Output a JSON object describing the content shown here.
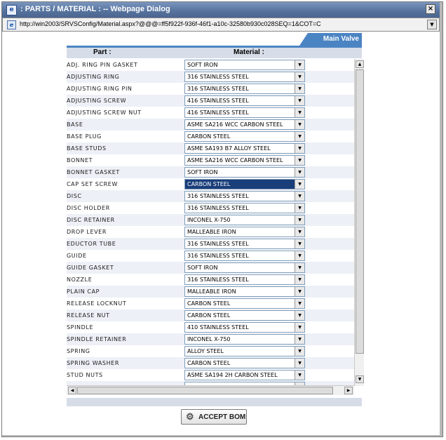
{
  "window": {
    "title": ": PARTS / MATERIAL : -- Webpage Dialog",
    "close_glyph": "×",
    "url": "http://win2003/SRVSConfig/Material.aspx?@@@=ff5f922f-936f-46f1-a10c-32580b930c028SEQ=1&COT=C"
  },
  "tab": {
    "label": "Main Valve"
  },
  "table": {
    "headers": {
      "part": "Part :",
      "material": "Material :"
    },
    "rows": [
      {
        "part": "ADJ. RING PIN GASKET",
        "material": "SOFT IRON"
      },
      {
        "part": "ADJUSTING RING",
        "material": "316 STAINLESS STEEL"
      },
      {
        "part": "ADJUSTING RING PIN",
        "material": "316 STAINLESS STEEL"
      },
      {
        "part": "ADJUSTING SCREW",
        "material": "416 STAINLESS STEEL"
      },
      {
        "part": "ADJUSTING SCREW NUT",
        "material": "416 STAINLESS STEEL"
      },
      {
        "part": "BASE",
        "material": "ASME SA216 WCC CARBON STEEL"
      },
      {
        "part": "BASE PLUG",
        "material": "CARBON STEEL"
      },
      {
        "part": "BASE STUDS",
        "material": "ASME SA193 B7 ALLOY STEEL"
      },
      {
        "part": "BONNET",
        "material": "ASME SA216 WCC CARBON STEEL"
      },
      {
        "part": "BONNET GASKET",
        "material": "SOFT IRON"
      },
      {
        "part": "CAP SET SCREW",
        "material": "CARBON STEEL",
        "selected": true
      },
      {
        "part": "DISC",
        "material": "316 STAINLESS STEEL"
      },
      {
        "part": "DISC HOLDER",
        "material": "316 STAINLESS STEEL"
      },
      {
        "part": "DISC RETAINER",
        "material": "INCONEL X-750"
      },
      {
        "part": "DROP LEVER",
        "material": "MALLEABLE IRON"
      },
      {
        "part": "EDUCTOR TUBE",
        "material": "316 STAINLESS STEEL"
      },
      {
        "part": "GUIDE",
        "material": "316 STAINLESS STEEL"
      },
      {
        "part": "GUIDE GASKET",
        "material": "SOFT IRON"
      },
      {
        "part": "NOZZLE",
        "material": "316 STAINLESS STEEL"
      },
      {
        "part": "PLAIN CAP",
        "material": "MALLEABLE IRON"
      },
      {
        "part": "RELEASE LOCKNUT",
        "material": "CARBON STEEL"
      },
      {
        "part": "RELEASE NUT",
        "material": "CARBON STEEL"
      },
      {
        "part": "SPINDLE",
        "material": "410 STAINLESS STEEL"
      },
      {
        "part": "SPINDLE RETAINER",
        "material": "INCONEL X-750"
      },
      {
        "part": "SPRING",
        "material": "ALLOY STEEL"
      },
      {
        "part": "SPRING WASHER",
        "material": "CARBON STEEL"
      },
      {
        "part": "STUD NUTS",
        "material": "ASME SA194 2H CARBON STEEL"
      },
      {
        "part": "",
        "material": ""
      }
    ]
  },
  "footer": {
    "accept_label": "ACCEPT BOM"
  },
  "colors": {
    "tab": "#4b84c3",
    "selected_row": "#1a3e7a",
    "header_band": "#d7dde8"
  },
  "icons": {
    "title": "ie-page-icon",
    "url": "ie-e-icon",
    "button": "gear-icon"
  }
}
